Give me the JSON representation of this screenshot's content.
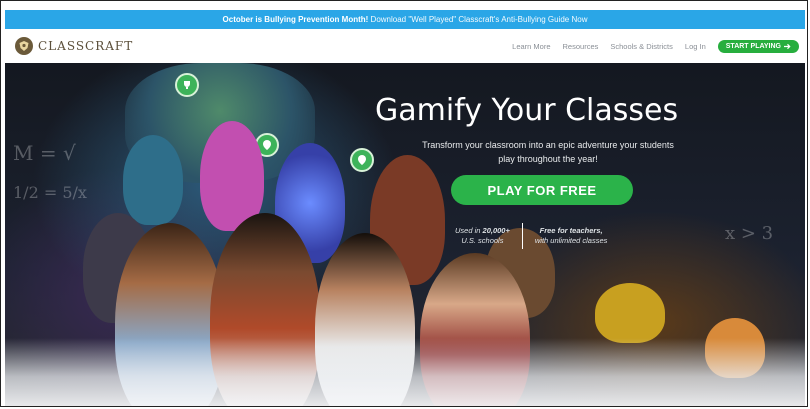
{
  "announcement": {
    "bold_text": "October is Bullying Prevention Month!",
    "link_text": "Download \"Well Played\" Classcraft's Anti-Bullying Guide Now"
  },
  "nav": {
    "logo_text": "CLASSCRAFT",
    "links": [
      "Learn More",
      "Resources",
      "Schools & Districts",
      "Log In"
    ],
    "cta_label": "START PLAYING",
    "cta_icon": "arrow-right-icon"
  },
  "hero": {
    "title": "Gamify Your Classes",
    "subtitle": "Transform your classroom into an epic adventure your students play throughout the year!",
    "button_label": "PLAY FOR FREE",
    "stat1_pre": "Used in",
    "stat1_value": "20,000+",
    "stat1_post": "U.S. schools",
    "stat2_bold": "Free for teachers,",
    "stat2_post": "with unlimited classes"
  },
  "chalkboard": {
    "formula1": "M = √",
    "formula2": "1/2 = 5/x",
    "formula3": "x > 3"
  },
  "colors": {
    "announcement_bg": "#2aa6e7",
    "cta_green": "#2bb34a",
    "logo_brown": "#5b4f3a"
  }
}
